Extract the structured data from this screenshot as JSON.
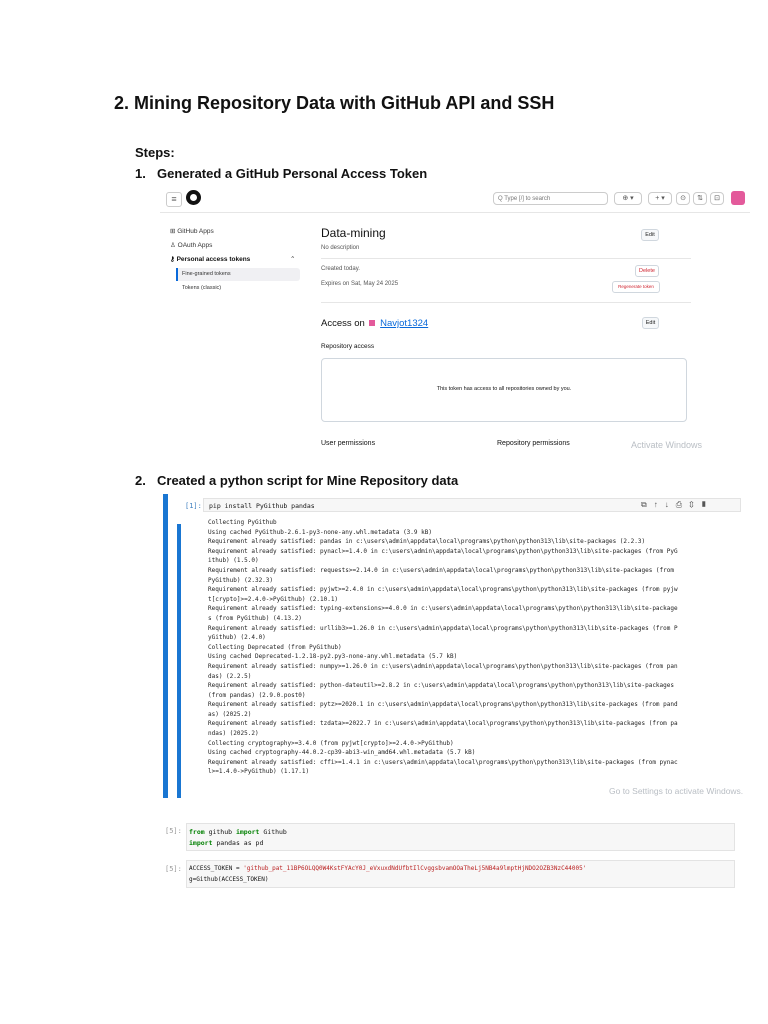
{
  "heading": "2. Mining Repository Data with GitHub API and SSH",
  "steps_label": "Steps:",
  "step1": {
    "num": "1.",
    "text": "Generated a GitHub Personal Access Token"
  },
  "step2": {
    "num": "2.",
    "text": "Created a python script for Mine Repository data"
  },
  "github": {
    "search_placeholder": "Q  Type [/] to search",
    "toolbar": [
      "⊕ ▾",
      "+ ▾",
      "⊙",
      "⇅",
      "⊡"
    ],
    "sidebar": [
      {
        "label": "⊞  GitHub Apps"
      },
      {
        "label": "♙  OAuth Apps"
      },
      {
        "label": "⚷  Personal access tokens",
        "chevron": "⌃"
      },
      {
        "label": "Fine-grained tokens"
      },
      {
        "label": "Tokens (classic)"
      }
    ],
    "token_name": "Data-mining",
    "description": "No description",
    "edit_label": "Edit",
    "created": "Created today.",
    "expires": "Expires on Sat, May 24 2025",
    "delete_label": "Delete",
    "regenerate_label": "Regenerate token",
    "access_prefix": "Access on",
    "access_user": "Navjot1324",
    "repo_access": "Repository access",
    "access_note": "This token has access to all repositories owned by you.",
    "user_permissions": "User permissions",
    "repo_permissions": "Repository permissions",
    "watermark": "Activate Windows"
  },
  "cell1": {
    "prompt": "[1]:",
    "input": "pip install PyGithub pandas",
    "output": [
      "Collecting PyGithub",
      "  Using cached PyGithub-2.6.1-py3-none-any.whl.metadata (3.9 kB)",
      "Requirement already satisfied: pandas in c:\\users\\admin\\appdata\\local\\programs\\python\\python313\\lib\\site-packages (2.2.3)",
      "Requirement already satisfied: pynacl>=1.4.0 in c:\\users\\admin\\appdata\\local\\programs\\python\\python313\\lib\\site-packages (from PyG",
      "ithub) (1.5.0)",
      "Requirement already satisfied: requests>=2.14.0 in c:\\users\\admin\\appdata\\local\\programs\\python\\python313\\lib\\site-packages (from",
      "PyGithub) (2.32.3)",
      "Requirement already satisfied: pyjwt>=2.4.0 in c:\\users\\admin\\appdata\\local\\programs\\python\\python313\\lib\\site-packages (from pyjw",
      "t[crypto]>=2.4.0->PyGithub) (2.10.1)",
      "Requirement already satisfied: typing-extensions>=4.0.0 in c:\\users\\admin\\appdata\\local\\programs\\python\\python313\\lib\\site-package",
      "s (from PyGithub) (4.13.2)",
      "Requirement already satisfied: urllib3>=1.26.0 in c:\\users\\admin\\appdata\\local\\programs\\python\\python313\\lib\\site-packages (from P",
      "yGithub) (2.4.0)",
      "Collecting Deprecated (from PyGithub)",
      "  Using cached Deprecated-1.2.18-py2.py3-none-any.whl.metadata (5.7 kB)",
      "Requirement already satisfied: numpy>=1.26.0 in c:\\users\\admin\\appdata\\local\\programs\\python\\python313\\lib\\site-packages (from pan",
      "das) (2.2.5)",
      "Requirement already satisfied: python-dateutil>=2.8.2 in c:\\users\\admin\\appdata\\local\\programs\\python\\python313\\lib\\site-packages",
      "(from pandas) (2.9.0.post0)",
      "Requirement already satisfied: pytz>=2020.1 in c:\\users\\admin\\appdata\\local\\programs\\python\\python313\\lib\\site-packages (from pand",
      "as) (2025.2)",
      "Requirement already satisfied: tzdata>=2022.7 in c:\\users\\admin\\appdata\\local\\programs\\python\\python313\\lib\\site-packages (from pa",
      "ndas) (2025.2)",
      "Collecting cryptography>=3.4.0 (from pyjwt[crypto]>=2.4.0->PyGithub)",
      "  Using cached cryptography-44.0.2-cp39-abi3-win_amd64.whl.metadata (5.7 kB)",
      "Requirement already satisfied: cffi>=1.4.1 in c:\\users\\admin\\appdata\\local\\programs\\python\\python313\\lib\\site-packages (from pynac",
      "l>=1.4.0->PyGithub) (1.17.1)"
    ],
    "watermark": "Go to Settings to activate Windows."
  },
  "cell5": {
    "prompt": "[5]:",
    "line1_kw1": "from",
    "line1_rest": " github ",
    "line1_kw2": "import",
    "line1_end": " Github",
    "line2_kw": "import",
    "line2_rest": " pandas as pd"
  },
  "cell6": {
    "prompt": "[5]:",
    "line1_var": "ACCESS_TOKEN = ",
    "line1_str": "'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'",
    "line2": "g=Github(ACCESS_TOKEN)"
  }
}
